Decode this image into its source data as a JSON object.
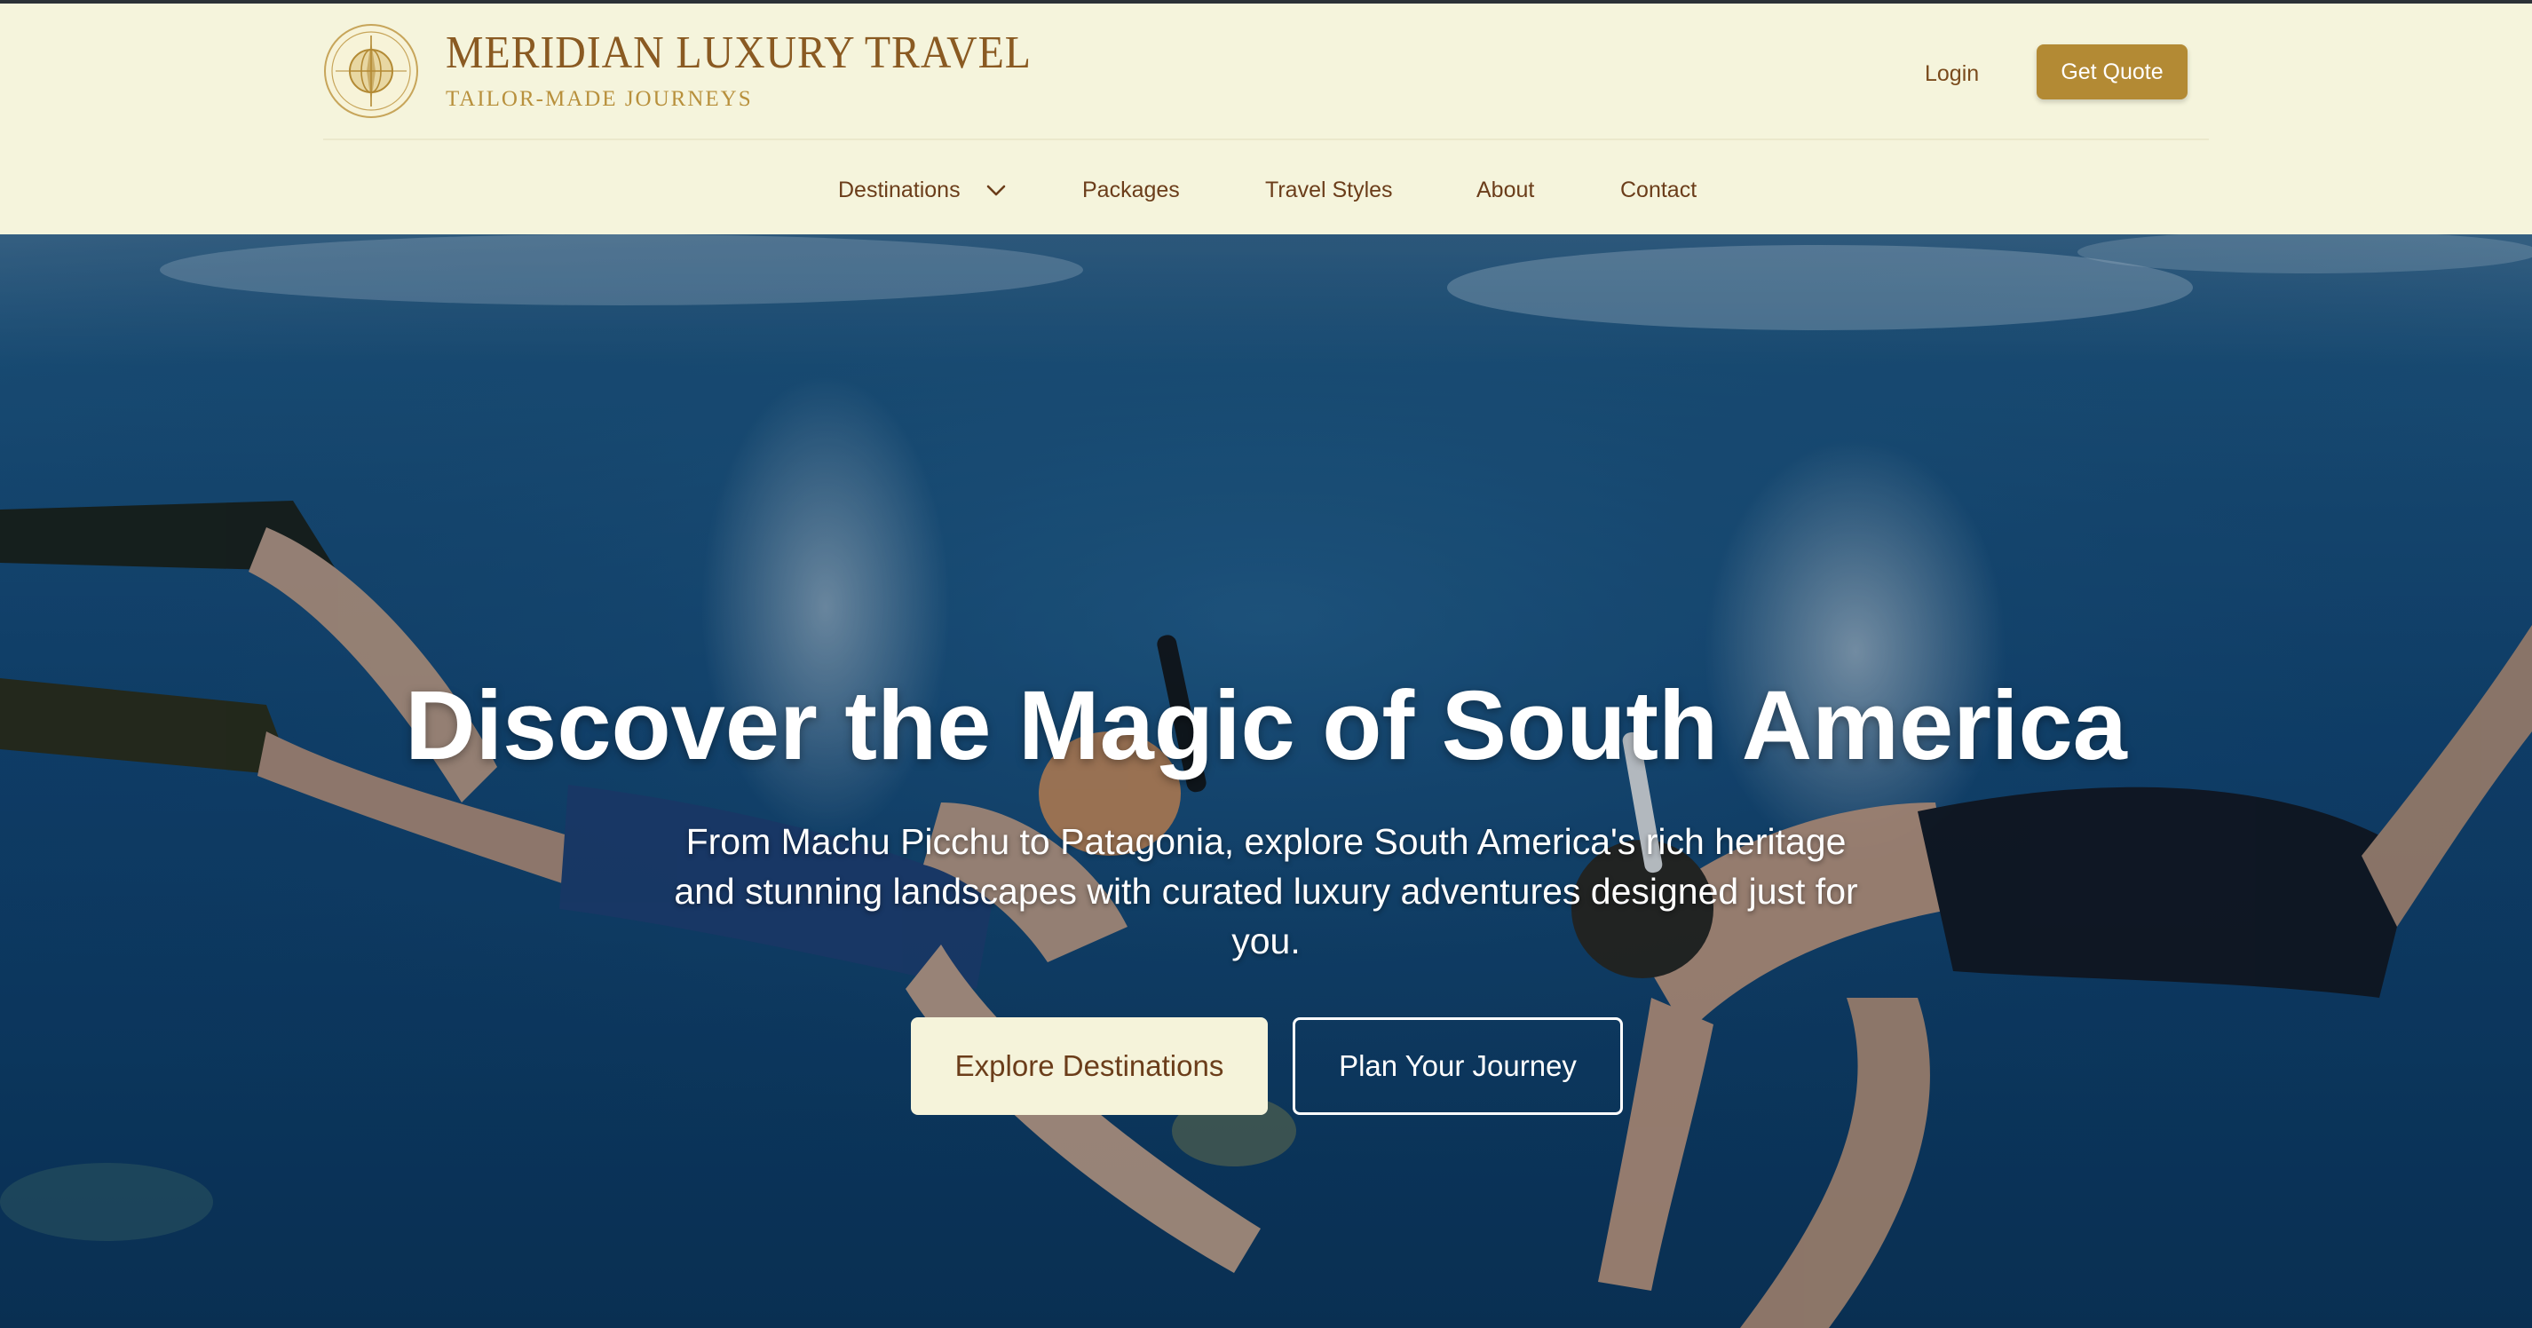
{
  "brand": {
    "name": "MERIDIAN LUXURY TRAVEL",
    "tagline": "TAILOR-MADE JOURNEYS",
    "logo_icon": "compass-globe-emblem-icon"
  },
  "header_actions": {
    "login_label": "Login",
    "quote_label": "Get Quote"
  },
  "nav": {
    "items": [
      {
        "label": "Destinations",
        "has_dropdown": true,
        "dropdown_icon": "chevron-down-icon"
      },
      {
        "label": "Packages"
      },
      {
        "label": "Travel Styles"
      },
      {
        "label": "About"
      },
      {
        "label": "Contact"
      }
    ]
  },
  "hero": {
    "title": "Discover the Magic of South America",
    "subtitle": "From Machu Picchu to Patagonia, explore South America's rich heritage and stunning landscapes with curated luxury adventures designed just for you.",
    "primary_cta": "Explore Destinations",
    "secondary_cta": "Plan Your Journey",
    "background": "underwater snorkelers and sea turtle photo"
  },
  "colors": {
    "header_bg": "#f5f4dc",
    "brand_brown": "#8a5a22",
    "brand_gold": "#b38a34",
    "nav_text": "#6b3d1a",
    "ocean_blue": "#0c3a62"
  }
}
